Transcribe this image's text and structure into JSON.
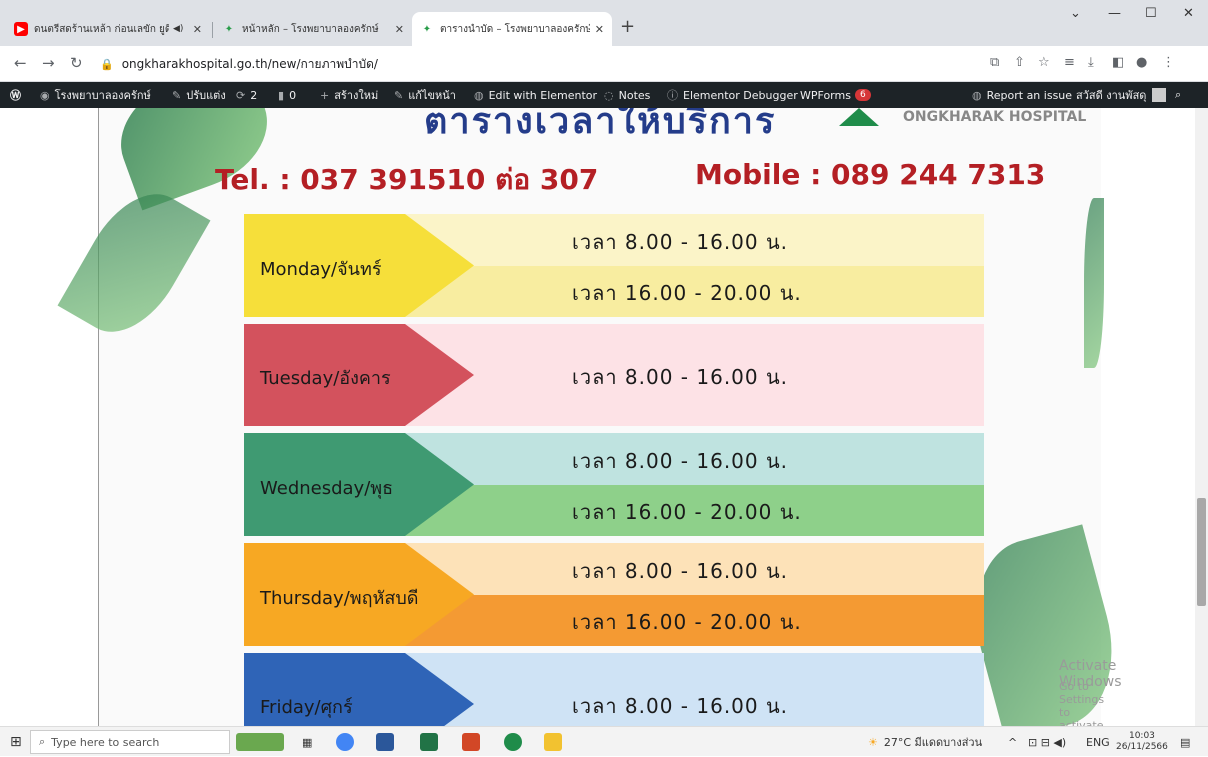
{
  "tabs": [
    {
      "title": "ดนตรีสดร้านเหล้า ก่อนเลขัก ยูดึ",
      "icon_color": "#ff0000"
    },
    {
      "title": "หน้าหลัก – โรงพยาบาลองครักษ์",
      "icon_color": "#2a9d4a"
    },
    {
      "title": "ตารางนำบัด – โรงพยาบาลองครักษ์",
      "icon_color": "#2a9d4a"
    }
  ],
  "url": "ongkharakhospital.go.th/new/กายภาพบำบัด/",
  "admin": {
    "site": "โรงพยาบาลองครักษ์",
    "customize": "ปรับแต่ง",
    "updates": "2",
    "comments": "0",
    "new": "สร้างใหม่",
    "edit": "แก้ไขหน้า",
    "elementor": "Edit with Elementor",
    "notes": "Notes",
    "debugger": "Elementor Debugger",
    "wpforms": "WPForms",
    "wpforms_count": "6",
    "report": "Report an issue",
    "greeting": "สวัสดี งานพัสดุ"
  },
  "poster": {
    "title": "ตารางเวลาให้บริการ",
    "hospital": "ONGKHARAK HOSPITAL",
    "tel": "Tel. : 037 391510 ต่อ 307",
    "mobile": "Mobile : 089 244 7313",
    "rows": [
      {
        "day": "Monday/จันทร์",
        "times": [
          "เวลา 8.00 - 16.00  น.",
          "เวลา 16.00 - 20.00  น."
        ],
        "arrow": "#f6df3a",
        "bands": [
          "#fbf4c8",
          "#f8eda0"
        ]
      },
      {
        "day": "Tuesday/อังคาร",
        "times": [
          "เวลา 8.00 - 16.00  น."
        ],
        "arrow": "#d3525d",
        "bands": [
          "#fde2e6"
        ]
      },
      {
        "day": "Wednesday/พุธ",
        "times": [
          "เวลา 8.00 - 16.00  น.",
          "เวลา 16.00 - 20.00  น."
        ],
        "arrow": "#3f9a72",
        "bands": [
          "#bfe3e0",
          "#8ed08a"
        ]
      },
      {
        "day": "Thursday/พฤหัสบดี",
        "times": [
          "เวลา 8.00 - 16.00  น.",
          "เวลา 16.00 - 20.00  น."
        ],
        "arrow": "#f7a823",
        "bands": [
          "#fde2b8",
          "#f49a33"
        ]
      },
      {
        "day": "Friday/ศุกร์",
        "times": [
          "เวลา 8.00 - 16.00  น."
        ],
        "arrow": "#2f64b7",
        "bands": [
          "#cfe3f5"
        ]
      }
    ]
  },
  "watermark": {
    "line1": "Activate Windows",
    "line2": "Go to Settings to activate Windows."
  },
  "taskbar": {
    "search": "Type here to search",
    "weather": "27°C มีแดดบางส่วน",
    "lang": "ENG",
    "time": "10:03",
    "date": "26/11/2566"
  }
}
